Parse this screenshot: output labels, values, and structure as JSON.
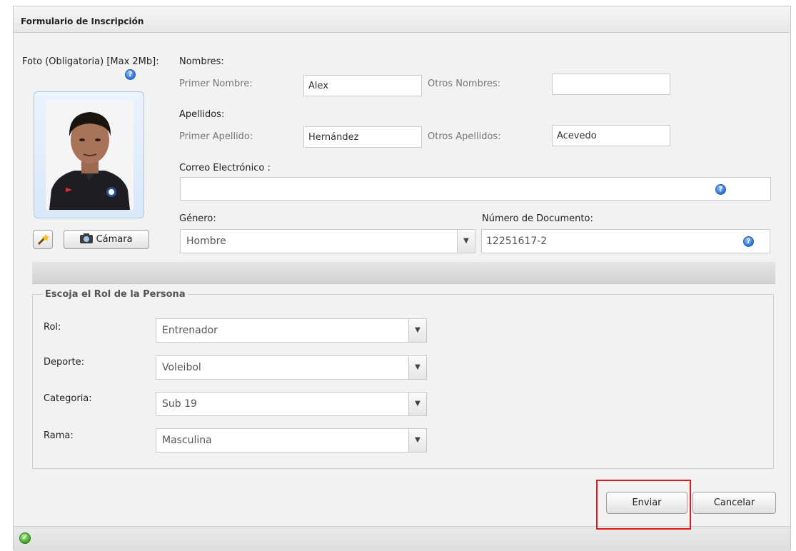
{
  "window": {
    "title": "Formulario de Inscripción"
  },
  "photo": {
    "label": "Foto (Obligatoria) [Max 2Mb]:",
    "camera_label": "Cámara"
  },
  "names": {
    "heading": "Nombres:",
    "first_label": "Primer Nombre:",
    "first_value": "Alex",
    "other_label": "Otros Nombres:",
    "other_value": ""
  },
  "surnames": {
    "heading": "Apellidos:",
    "first_label": "Primer Apellido:",
    "first_value": "Hernández",
    "other_label": "Otros Apellidos:",
    "other_value": "Acevedo"
  },
  "email": {
    "label": "Correo Electrónico :",
    "value": ""
  },
  "gender": {
    "label": "Género:",
    "value": "Hombre"
  },
  "document": {
    "label": "Número de Documento:",
    "value": "12251617-2"
  },
  "role_section": {
    "legend": "Escoja el Rol de la Persona",
    "fields": [
      {
        "label": "Rol:",
        "value": "Entrenador"
      },
      {
        "label": "Deporte:",
        "value": "Voleibol"
      },
      {
        "label": "Categoria:",
        "value": "Sub 19"
      },
      {
        "label": "Rama:",
        "value": "Masculina"
      }
    ]
  },
  "actions": {
    "submit_label": "Enviar",
    "cancel_label": "Cancelar"
  },
  "icons": {
    "help": "help-icon",
    "wand": "magic-wand-icon",
    "camera": "camera-icon",
    "status": "check-circle-icon",
    "dropdown": "chevron-down-icon"
  },
  "colors": {
    "highlight": "#e01818",
    "status_ok": "#3aa11f",
    "help": "#2e6fd2"
  }
}
